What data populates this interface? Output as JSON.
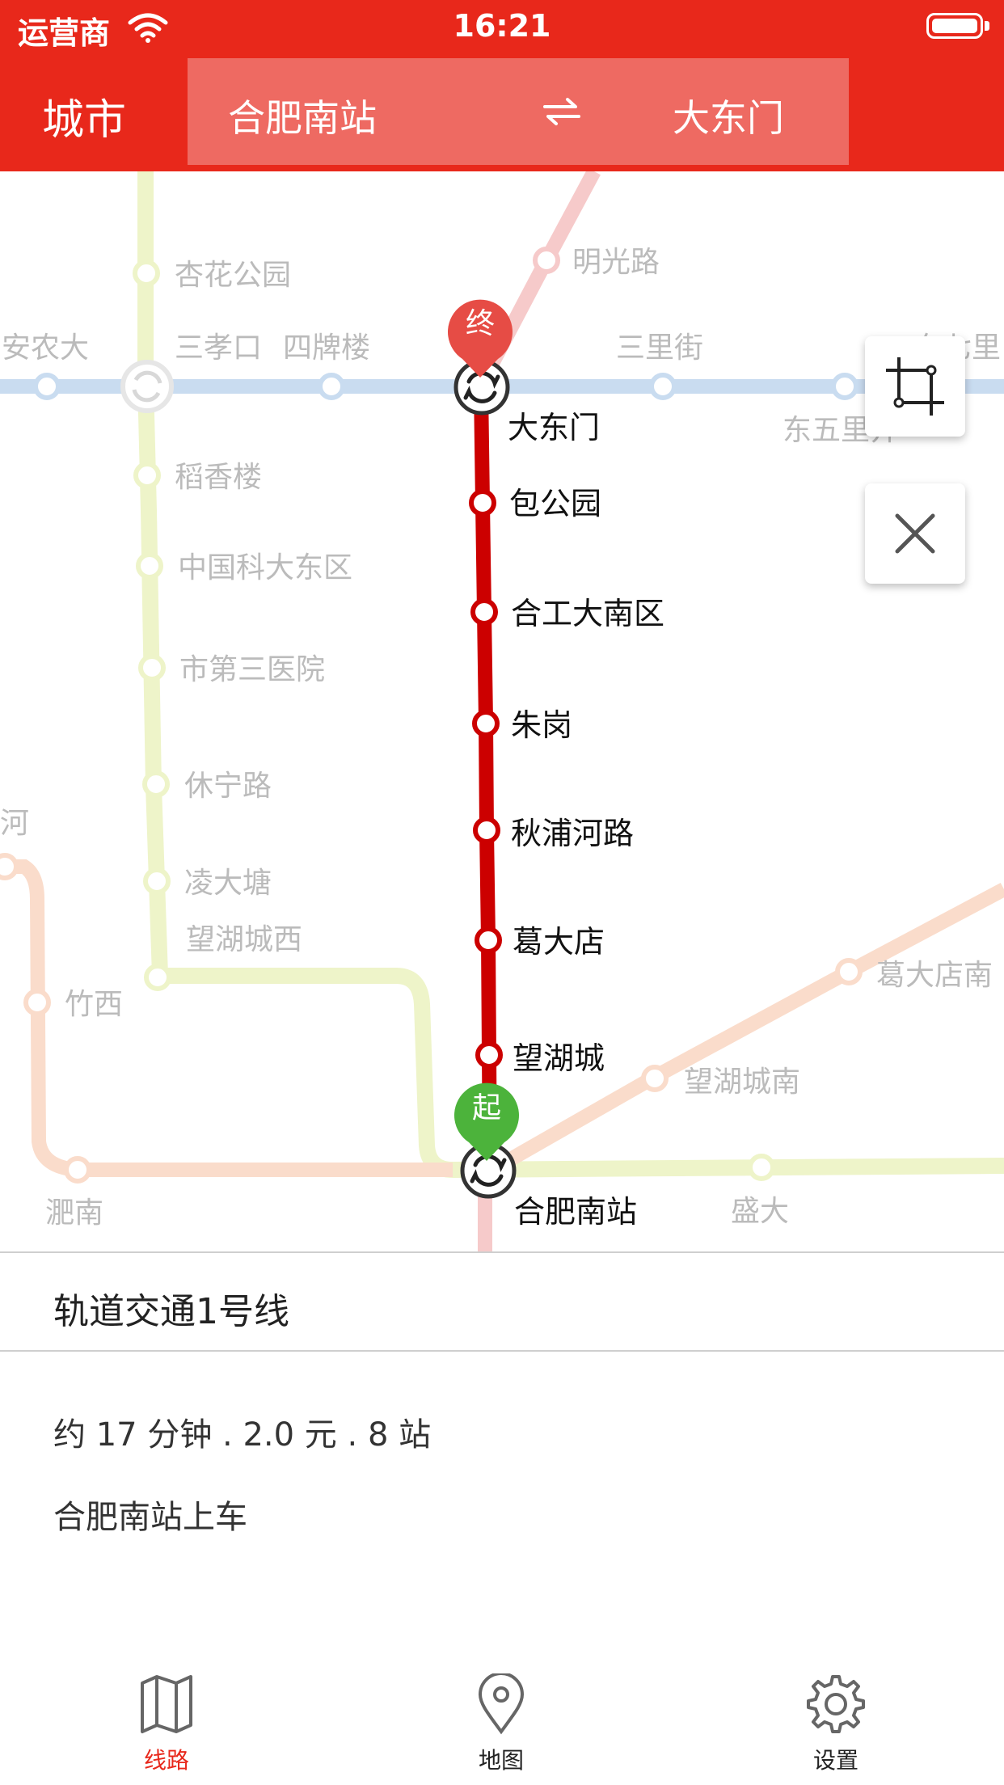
{
  "status_bar": {
    "carrier": "运营商",
    "time": "16:21"
  },
  "header": {
    "city_label": "城市",
    "from_station": "合肥南站",
    "to_station": "大东门"
  },
  "map": {
    "end_marker": "终",
    "start_marker": "起",
    "route_stations": [
      "大东门",
      "包公园",
      "合工大南区",
      "朱岗",
      "秋浦河路",
      "葛大店",
      "望湖城",
      "合肥南站"
    ],
    "other_labels": {
      "line3_a": "杏花公园",
      "line3_b": "稻香楼",
      "line3_c": "中国科大东区",
      "line3_d": "市第三医院",
      "line3_e": "休宁路",
      "line3_f": "凌大塘",
      "line3_g": "望湖城西",
      "line2_a": "安农大",
      "line2_b": "三孝口",
      "line2_c": "四牌楼",
      "line2_d": "三里街",
      "line2_e": "东五里井",
      "line2_f": "东七里",
      "pink_a": "明光路",
      "orange_a": "河",
      "orange_b": "竹西",
      "orange_c": "淝南",
      "line4_a": "葛大店南",
      "line4_b": "望湖城南",
      "line4_c": "盛大"
    },
    "colors": {
      "route": "#CC0000",
      "line2": "#C9DCF0",
      "line3": "#EEF4C9",
      "pink": "#F6CACA",
      "orange": "#FADCCB",
      "brand": "#E8281B"
    }
  },
  "route_info": {
    "line_name": "轨道交通1号线",
    "summary": "约 17 分钟 . 2.0 元 . 8 站",
    "boarding": "合肥南站上车"
  },
  "tabs": [
    {
      "label": "线路",
      "icon": "map-icon",
      "active": true
    },
    {
      "label": "地图",
      "icon": "location-pin-icon",
      "active": false
    },
    {
      "label": "设置",
      "icon": "gear-icon",
      "active": false
    }
  ]
}
